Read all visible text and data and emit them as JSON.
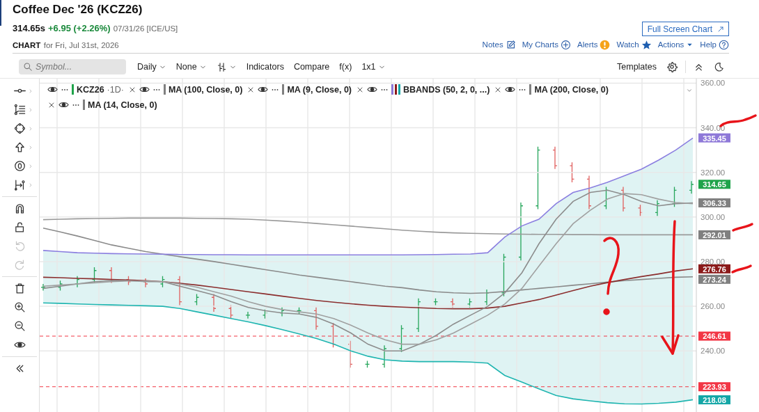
{
  "header": {
    "title": "Coffee Dec '26 (KCZ26)",
    "last_price": "314.65s",
    "change": "+6.95 (+2.26%)",
    "timestamp": "07/31/26 [ICE/US]",
    "full_screen_button": "Full Screen Chart",
    "chart_label": "CHART",
    "chart_date": "for Fri, Jul 31st, 2026",
    "links": [
      {
        "label": "Notes"
      },
      {
        "label": "My Charts"
      },
      {
        "label": "Alerts"
      },
      {
        "label": "Watch"
      },
      {
        "label": "Actions"
      },
      {
        "label": "Help"
      }
    ]
  },
  "toolbar": {
    "search_placeholder": "Symbol...",
    "items": [
      {
        "label": "Daily",
        "kind": "dropdown"
      },
      {
        "label": "None",
        "kind": "dropdown"
      },
      {
        "kind": "bar_type"
      },
      {
        "label": "Indicators",
        "kind": "button"
      },
      {
        "label": "Compare",
        "kind": "button"
      },
      {
        "label": "f(x)",
        "kind": "button"
      },
      {
        "label": "1x1",
        "kind": "dropdown"
      }
    ],
    "right_items": [
      {
        "label": "Templates",
        "kind": "button"
      },
      {
        "kind": "settings"
      },
      {
        "kind": "collapse"
      },
      {
        "kind": "theme"
      }
    ]
  },
  "drawing_tools": [
    {
      "disabled": false,
      "has_menu": true
    },
    {
      "disabled": false,
      "has_menu": true
    },
    {
      "disabled": false,
      "has_menu": true
    },
    {
      "disabled": false,
      "has_menu": true
    },
    {
      "disabled": false,
      "has_menu": true
    },
    {
      "disabled": false,
      "has_menu": true
    },
    {
      "disabled": false,
      "has_menu": false
    },
    {
      "disabled": false,
      "has_menu": false
    },
    {
      "disabled": true,
      "has_menu": false
    },
    {
      "disabled": true,
      "has_menu": false
    },
    {
      "disabled": false,
      "has_menu": false
    },
    {
      "disabled": false,
      "has_menu": false
    },
    {
      "disabled": false,
      "has_menu": false
    },
    {
      "disabled": false,
      "has_menu": false
    },
    {
      "disabled": false,
      "has_menu": false
    }
  ],
  "chart": {
    "legend": [
      {
        "label": "KCZ26",
        "interval": "·1D·",
        "swatches": [
          {
            "color": "#1fa34a"
          }
        ]
      },
      {
        "label": "MA (100, Close, 0)",
        "swatches": [
          {
            "color": "#808080"
          }
        ]
      },
      {
        "label": "MA (9, Close, 0)",
        "swatches": [
          {
            "color": "#808080"
          }
        ]
      },
      {
        "label": "BBANDS (50, 2, 0, ...)",
        "swatches": [
          {
            "color": "#8e78d8"
          },
          {
            "color": "#8b1a1a"
          },
          {
            "color": "#14a6a6"
          }
        ]
      },
      {
        "label": "MA (200, Close, 0)",
        "swatches": [
          {
            "color": "#808080"
          }
        ]
      },
      {
        "label": "MA (14, Close, 0)",
        "swatches": [
          {
            "color": "#808080"
          }
        ]
      }
    ],
    "price_tags": [
      {
        "label": "335.45",
        "color": "#8e78d8",
        "kind": "tag"
      },
      {
        "label": "314.65",
        "color": "#1fa34a",
        "kind": "tag"
      },
      {
        "label": "306.33",
        "color": "#808080",
        "kind": "tag"
      },
      {
        "label": "292.01",
        "color": "#808080",
        "kind": "tag"
      },
      {
        "label": "276.76",
        "color": "#8b1a1a",
        "kind": "tag"
      },
      {
        "label": "273.24",
        "color": "#808080",
        "kind": "tag"
      },
      {
        "label": "246.61",
        "color": "#f23645",
        "kind": "level_line"
      },
      {
        "label": "223.93",
        "color": "#f23645",
        "kind": "level_line"
      },
      {
        "label": "218.08",
        "color": "#14a6a6",
        "kind": "tag"
      }
    ],
    "chart_data": {
      "type": "line",
      "grid": true,
      "ylim": [
        212.3,
        362
      ],
      "yticks": [
        {
          "value": 240,
          "label": "240.00"
        },
        {
          "value": 260,
          "label": "260.00"
        },
        {
          "value": 280,
          "label": "280.00"
        },
        {
          "value": 300,
          "label": "300.00"
        },
        {
          "value": 320,
          "label": "320.00"
        },
        {
          "value": 340,
          "label": "340.00"
        },
        {
          "value": 360,
          "label": "360.00"
        }
      ],
      "categories": [
        null,
        null,
        null,
        null,
        null,
        null,
        null,
        null,
        null,
        null,
        null,
        null,
        null,
        null,
        null,
        null,
        null,
        null,
        null,
        null,
        null,
        null,
        null,
        null,
        null,
        null,
        null,
        null,
        null,
        null,
        null,
        null,
        null,
        null,
        null,
        null,
        null,
        null,
        null
      ],
      "series": [
        {
          "color": "#9a9a9a",
          "values": [
            298.8,
            299,
            299.2,
            299.3,
            299.4,
            299.5,
            299.5,
            299.5,
            299.5,
            299.4,
            299.3,
            299.2,
            299,
            298.6,
            298.2,
            297.7,
            297.1,
            296.5,
            295.9,
            295.3,
            294.7,
            294.1,
            293.6,
            293.2,
            292.9,
            292.7,
            292.5,
            292.4,
            292.3,
            292.2,
            292.2,
            292.1,
            292.1,
            292,
            292,
            292,
            292,
            292,
            292
          ]
        },
        {
          "color": "#8a8a8a",
          "values": [
            295,
            293.3,
            291.5,
            289.5,
            287.5,
            286,
            284.5,
            283.3,
            282.2,
            281.1,
            280,
            278.8,
            277.6,
            276.4,
            275.2,
            274,
            273,
            272,
            271,
            270,
            269,
            268.3,
            267.3,
            266.5,
            266,
            265.8,
            266,
            266.6,
            267.3,
            268,
            268.7,
            269.4,
            270.1,
            270.8,
            271.5,
            272,
            272.5,
            273,
            273.2
          ]
        },
        {
          "color": "#8b7fe0",
          "values": [
            285,
            284.5,
            284,
            283.8,
            283.6,
            283.5,
            283.4,
            283.3,
            283.2,
            283.2,
            283.1,
            283.1,
            283,
            283,
            283,
            283,
            283,
            283,
            283,
            283,
            283,
            283,
            283.1,
            283.2,
            283.3,
            283.4,
            284,
            291,
            296,
            299,
            306,
            311,
            313,
            315.5,
            318.5,
            321.5,
            325.5,
            330,
            335.4
          ]
        },
        {
          "color": "#8b2e2e",
          "values": [
            273,
            272.8,
            272.5,
            272.3,
            272,
            271.8,
            271.5,
            271,
            270.3,
            269.5,
            268.5,
            267.5,
            266.5,
            265.5,
            264.5,
            263.5,
            262.6,
            261.8,
            261.1,
            260.5,
            260,
            259.6,
            259.3,
            259,
            258.9,
            258.9,
            259.2,
            260,
            261.5,
            263,
            265,
            267,
            269,
            270.6,
            272,
            273.3,
            274.5,
            275.8,
            276.8
          ]
        },
        {
          "color": "#1fb5b0",
          "values": [
            261.5,
            261.3,
            261,
            260.8,
            260.6,
            260.4,
            260.2,
            260,
            259,
            257.5,
            256,
            254.5,
            253,
            251.3,
            249.5,
            247.5,
            245.5,
            243,
            240,
            237.6,
            236,
            235.4,
            235.2,
            235.2,
            235.2,
            235,
            234.5,
            229,
            226,
            223,
            220,
            218.5,
            217.6,
            216.8,
            216.3,
            216.2,
            216.5,
            217,
            218.1
          ]
        },
        {
          "color": "#8c8c8c",
          "values": [
            268,
            269,
            270,
            271,
            271.5,
            271.5,
            271,
            271,
            269,
            267,
            265,
            262,
            259.5,
            258,
            257,
            256.5,
            255,
            252,
            248,
            243,
            240,
            240,
            243,
            247,
            252,
            256,
            260,
            266,
            275,
            288,
            299,
            307,
            311,
            312,
            310,
            307,
            305,
            306,
            306.3
          ]
        },
        {
          "color": "#a0a0a0",
          "values": [
            269,
            269.5,
            270,
            270.5,
            271,
            271.3,
            271.3,
            271,
            270,
            268.5,
            266.5,
            264.5,
            262,
            260,
            258.5,
            257.5,
            256.5,
            254.5,
            251.5,
            248,
            245,
            243,
            243,
            245,
            248,
            252,
            256,
            261,
            268,
            278,
            288,
            297,
            303,
            308,
            310.5,
            310,
            308,
            306.5,
            306
          ]
        }
      ]
    }
  }
}
